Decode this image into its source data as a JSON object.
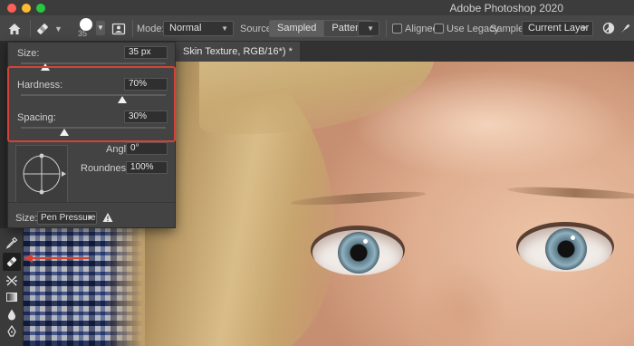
{
  "window": {
    "app_title": "Adobe Photoshop 2020"
  },
  "options_bar": {
    "brush_size_value": "35",
    "mode_label": "Mode:",
    "mode_value": "Normal",
    "source_label": "Source:",
    "source_options": [
      "Sampled",
      "Pattern"
    ],
    "source_selected": "Sampled",
    "aligned_label": "Aligned",
    "use_legacy_label": "Use Legacy",
    "sample_label": "Sample:",
    "sample_value": "Current Layer"
  },
  "document": {
    "tab_title": "Skin Texture, RGB/16*) *"
  },
  "brush_popover": {
    "size_label": "Size:",
    "size_value": "35 px",
    "hardness_label": "Hardness:",
    "hardness_value": "70%",
    "hardness_level": 0.7,
    "spacing_label": "Spacing:",
    "spacing_value": "30%",
    "spacing_level": 0.3,
    "angle_label": "Angle:",
    "angle_value": "0°",
    "roundness_label": "Roundness:",
    "roundness_value": "100%",
    "pressure_size_label": "Size:",
    "pressure_size_value": "Pen Pressure"
  },
  "toolbar": {
    "tools": [
      "eyedropper-icon",
      "healing-brush-icon",
      "crop-icon",
      "gradient-icon",
      "dodge-icon",
      "pen-icon"
    ],
    "active_tool": "healing-brush-icon"
  },
  "colors": {
    "highlight": "#d44237",
    "panel": "#434343",
    "options_bar": "#474747"
  }
}
